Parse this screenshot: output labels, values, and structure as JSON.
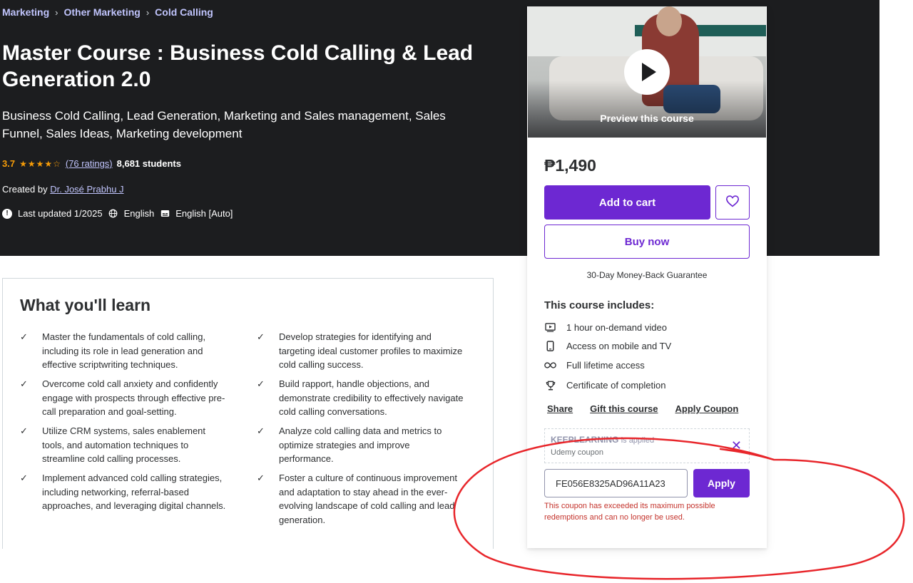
{
  "breadcrumb": [
    "Marketing",
    "Other Marketing",
    "Cold Calling"
  ],
  "course": {
    "title": "Master Course : Business Cold Calling & Lead Generation 2.0",
    "subtitle": "Business Cold Calling, Lead Generation, Marketing and Sales management, Sales Funnel, Sales Ideas, Marketing development",
    "rating": "3.7",
    "stars": "★★★★☆",
    "ratings_link": "(76 ratings)",
    "students": "8,681 students",
    "created_by_label": "Created by",
    "instructor": "Dr. José Prabhu J",
    "last_updated": "Last updated 1/2025",
    "language": "English",
    "captions": "English [Auto]"
  },
  "learn": {
    "title": "What you'll learn",
    "items": [
      "Master the fundamentals of cold calling, including its role in lead generation and effective scriptwriting techniques.",
      "Develop strategies for identifying and targeting ideal customer profiles to maximize cold calling success.",
      "Overcome cold call anxiety and confidently engage with prospects through effective pre-call preparation and goal-setting.",
      "Build rapport, handle objections, and demonstrate credibility to effectively navigate cold calling conversations.",
      "Utilize CRM systems, sales enablement tools, and automation techniques to streamline cold calling processes.",
      "Analyze cold calling data and metrics to optimize strategies and improve performance.",
      "Implement advanced cold calling strategies, including networking, referral-based approaches, and leveraging digital channels.",
      "Foster a culture of continuous improvement and adaptation to stay ahead in the ever-evolving landscape of cold calling and lead generation."
    ]
  },
  "sidebar": {
    "preview_label": "Preview this course",
    "price": "₱1,490",
    "add_to_cart": "Add to cart",
    "buy_now": "Buy now",
    "guarantee": "30-Day Money-Back Guarantee",
    "includes_title": "This course includes:",
    "includes": [
      {
        "icon": "video-icon",
        "text": "1 hour on-demand video"
      },
      {
        "icon": "mobile-icon",
        "text": "Access on mobile and TV"
      },
      {
        "icon": "infinity-icon",
        "text": "Full lifetime access"
      },
      {
        "icon": "trophy-icon",
        "text": "Certificate of completion"
      }
    ],
    "links": {
      "share": "Share",
      "gift": "Gift this course",
      "apply_coupon": "Apply Coupon"
    },
    "coupon": {
      "code": "KEEPLEARNING",
      "status": "is applied",
      "type": "Udemy coupon",
      "input_value": "FE056E8325AD96A11A23",
      "apply": "Apply",
      "error": "This coupon has exceeded its maximum possible redemptions and can no longer be used."
    }
  },
  "colors": {
    "hero_bg": "#1c1d1f",
    "accent": "#6d28d2",
    "link_purple": "#c0c4fc",
    "star": "#f69c08",
    "error": "#c4342d",
    "annotation": "#e8262b"
  }
}
